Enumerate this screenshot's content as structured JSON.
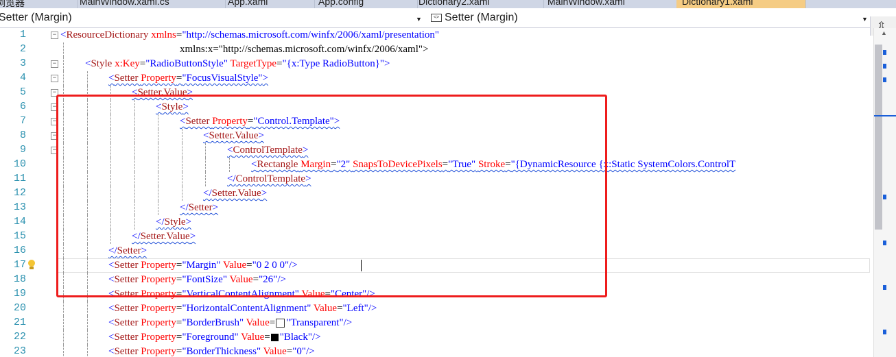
{
  "tabs": [
    {
      "label": "浏览器",
      "active": false
    },
    {
      "label": "MainWindow.xaml.cs",
      "active": false
    },
    {
      "label": "App.xaml",
      "active": false
    },
    {
      "label": "App.config",
      "active": false
    },
    {
      "label": "Dictionary2.xaml",
      "active": false
    },
    {
      "label": "MainWindow.xaml",
      "active": false
    },
    {
      "label": "Dictionary1.xaml",
      "active": true
    }
  ],
  "nav": {
    "left_scope": "Setter (Margin)",
    "right_scope": "Setter (Margin)",
    "right_icon": "element-icon"
  },
  "editor": {
    "current_line": 17,
    "highlight_color": "#ee1c1c",
    "lines": [
      {
        "n": "1",
        "text": "<ResourceDictionary xmlns=\"http://schemas.microsoft.com/winfx/2006/xaml/presentation\""
      },
      {
        "n": "2",
        "text": "xmlns:x=\"http://schemas.microsoft.com/winfx/2006/xaml\">"
      },
      {
        "n": "3",
        "text": "<Style x:Key=\"RadioButtonStyle\" TargetType=\"{x:Type RadioButton}\">"
      },
      {
        "n": "4",
        "text": "<Setter Property=\"FocusVisualStyle\">"
      },
      {
        "n": "5",
        "text": "<Setter.Value>"
      },
      {
        "n": "6",
        "text": "<Style>"
      },
      {
        "n": "7",
        "text": "<Setter Property=\"Control.Template\">"
      },
      {
        "n": "8",
        "text": "<Setter.Value>"
      },
      {
        "n": "9",
        "text": "<ControlTemplate>"
      },
      {
        "n": "10",
        "text": "<Rectangle Margin=\"2\" SnapsToDevicePixels=\"True\" Stroke=\"{DynamicResource {x:Static SystemColors.ControlT"
      },
      {
        "n": "11",
        "text": "</ControlTemplate>"
      },
      {
        "n": "12",
        "text": "</Setter.Value>"
      },
      {
        "n": "13",
        "text": "</Setter>"
      },
      {
        "n": "14",
        "text": "</Style>"
      },
      {
        "n": "15",
        "text": "</Setter.Value>"
      },
      {
        "n": "16",
        "text": "</Setter>"
      },
      {
        "n": "17",
        "text": "<Setter Property=\"Margin\" Value=\"0 2 0 0\"/>"
      },
      {
        "n": "18",
        "text": "<Setter Property=\"FontSize\" Value=\"26\"/>"
      },
      {
        "n": "19",
        "text": "<Setter Property=\"VerticalContentAlignment\" Value=\"Center\"/>"
      },
      {
        "n": "20",
        "text": "<Setter Property=\"HorizontalContentAlignment\" Value=\"Left\"/>"
      },
      {
        "n": "21",
        "text": "<Setter Property=\"BorderBrush\" Value=\"Transparent\"/>"
      },
      {
        "n": "22",
        "text": "<Setter Property=\"Foreground\" Value=\"Black\"/>"
      },
      {
        "n": "23",
        "text": "<Setter Property=\"BorderThickness\" Value=\"0\"/>"
      }
    ]
  }
}
